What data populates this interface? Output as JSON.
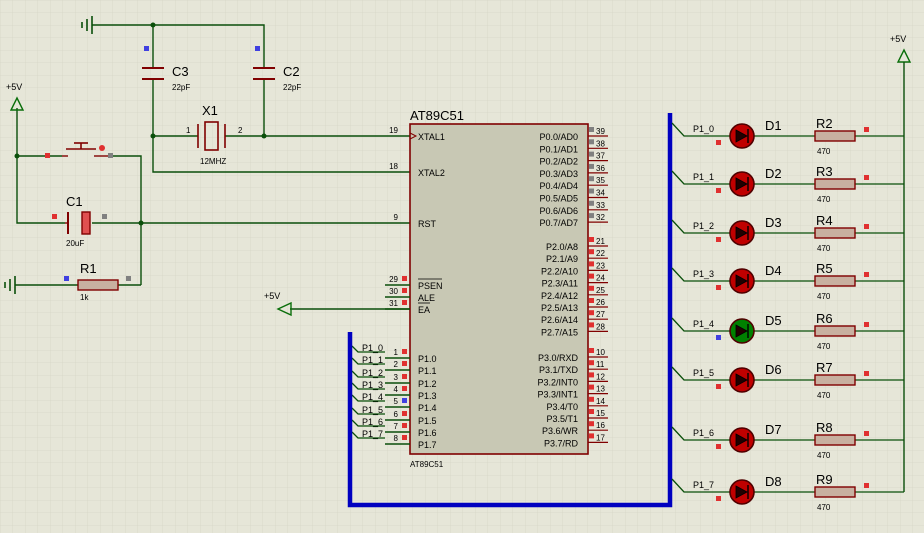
{
  "colors": {
    "background": "#e6e6d8",
    "grid": "#d2d2c4",
    "wire": "#0a4f0a",
    "component": "#800000",
    "chip_fill": "#c8c8b4",
    "bus": "#0000c0",
    "led_red": "#c00000",
    "led_green": "#008000",
    "pin_red": "#e03030",
    "pin_blue": "#4040e0",
    "pin_gray": "#808080",
    "power": "#0a6e0a"
  },
  "mcu": {
    "title": "AT89C51",
    "footer": "AT89C51",
    "left_pins": [
      {
        "num": "19",
        "name": "XTAL1"
      },
      {
        "num": "18",
        "name": "XTAL2"
      },
      {
        "num": "9",
        "name": "RST"
      },
      {
        "num": "29",
        "name": "PSEN"
      },
      {
        "num": "30",
        "name": "ALE"
      },
      {
        "num": "31",
        "name": "EA"
      },
      {
        "num": "1",
        "name": "P1.0"
      },
      {
        "num": "2",
        "name": "P1.1"
      },
      {
        "num": "3",
        "name": "P1.2"
      },
      {
        "num": "4",
        "name": "P1.3"
      },
      {
        "num": "5",
        "name": "P1.4"
      },
      {
        "num": "6",
        "name": "P1.5"
      },
      {
        "num": "7",
        "name": "P1.6"
      },
      {
        "num": "8",
        "name": "P1.7"
      }
    ],
    "right_pins": [
      {
        "num": "39",
        "name": "P0.0/AD0"
      },
      {
        "num": "38",
        "name": "P0.1/AD1"
      },
      {
        "num": "37",
        "name": "P0.2/AD2"
      },
      {
        "num": "36",
        "name": "P0.3/AD3"
      },
      {
        "num": "35",
        "name": "P0.4/AD4"
      },
      {
        "num": "34",
        "name": "P0.5/AD5"
      },
      {
        "num": "33",
        "name": "P0.6/AD6"
      },
      {
        "num": "32",
        "name": "P0.7/AD7"
      },
      {
        "num": "21",
        "name": "P2.0/A8"
      },
      {
        "num": "22",
        "name": "P2.1/A9"
      },
      {
        "num": "23",
        "name": "P2.2/A10"
      },
      {
        "num": "24",
        "name": "P2.3/A11"
      },
      {
        "num": "25",
        "name": "P2.4/A12"
      },
      {
        "num": "26",
        "name": "P2.5/A13"
      },
      {
        "num": "27",
        "name": "P2.6/A14"
      },
      {
        "num": "28",
        "name": "P2.7/A15"
      },
      {
        "num": "10",
        "name": "P3.0/RXD"
      },
      {
        "num": "11",
        "name": "P3.1/TXD"
      },
      {
        "num": "12",
        "name": "P3.2/INT0"
      },
      {
        "num": "13",
        "name": "P3.3/INT1"
      },
      {
        "num": "14",
        "name": "P3.4/T0"
      },
      {
        "num": "15",
        "name": "P3.5/T1"
      },
      {
        "num": "16",
        "name": "P3.6/WR"
      },
      {
        "num": "17",
        "name": "P3.7/RD"
      }
    ]
  },
  "p1_labels": [
    "P1_0",
    "P1_1",
    "P1_2",
    "P1_3",
    "P1_4",
    "P1_5",
    "P1_6",
    "P1_7"
  ],
  "crystal": {
    "ref": "X1",
    "value": "12MHZ",
    "pin1": "1",
    "pin2": "2"
  },
  "caps": [
    {
      "ref": "C3",
      "value": "22pF"
    },
    {
      "ref": "C2",
      "value": "22pF"
    },
    {
      "ref": "C1",
      "value": "20uF"
    }
  ],
  "reset_resistor": {
    "ref": "R1",
    "value": "1k"
  },
  "power": {
    "label": "+5V"
  },
  "leds": [
    {
      "ref": "D1",
      "state": "off"
    },
    {
      "ref": "D2",
      "state": "off"
    },
    {
      "ref": "D3",
      "state": "off"
    },
    {
      "ref": "D4",
      "state": "off"
    },
    {
      "ref": "D5",
      "state": "on"
    },
    {
      "ref": "D6",
      "state": "off"
    },
    {
      "ref": "D7",
      "state": "off"
    },
    {
      "ref": "D8",
      "state": "off"
    }
  ],
  "led_resistors": [
    {
      "ref": "R2",
      "value": "470"
    },
    {
      "ref": "R3",
      "value": "470"
    },
    {
      "ref": "R4",
      "value": "470"
    },
    {
      "ref": "R5",
      "value": "470"
    },
    {
      "ref": "R6",
      "value": "470"
    },
    {
      "ref": "R7",
      "value": "470"
    },
    {
      "ref": "R8",
      "value": "470"
    },
    {
      "ref": "R9",
      "value": "470"
    }
  ]
}
